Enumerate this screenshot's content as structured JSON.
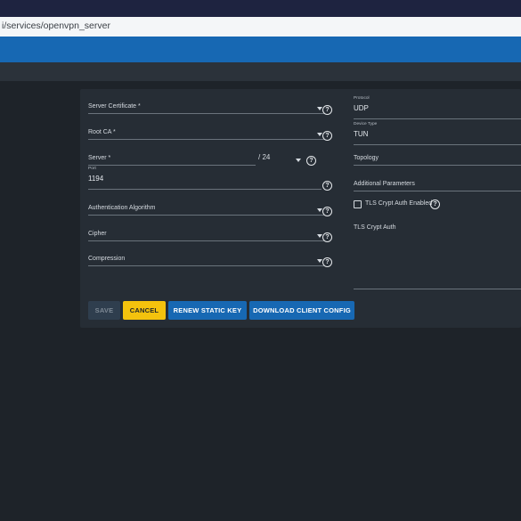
{
  "browser": {
    "url": "i/services/openvpn_server"
  },
  "form": {
    "server_certificate": {
      "label": "Server Certificate *",
      "help_icon": "help-circle-icon"
    },
    "root_ca": {
      "label": "Root CA *"
    },
    "server": {
      "label": "Server *",
      "netmask": "/ 24"
    },
    "port": {
      "label": "Port",
      "value": "1194"
    },
    "auth_algorithm": {
      "label": "Authentication Algorithm"
    },
    "cipher": {
      "label": "Cipher"
    },
    "compression": {
      "label": "Compression"
    },
    "protocol": {
      "label": "Protocol",
      "value": "UDP"
    },
    "device_type": {
      "label": "Device Type",
      "value": "TUN"
    },
    "topology": {
      "label": "Topology"
    },
    "additional_parameters": {
      "label": "Additional Parameters"
    },
    "tls_crypt_auth_enabled": {
      "label": "TLS Crypt Auth Enabled",
      "checked": false
    },
    "tls_crypt_auth": {
      "label": "TLS Crypt Auth"
    }
  },
  "buttons": {
    "save": "SAVE",
    "cancel": "CANCEL",
    "renew": "RENEW STATIC KEY",
    "download": "DOWNLOAD CLIENT CONFIG"
  },
  "colors": {
    "primary": "#1768b3",
    "accent": "#f4c20d",
    "background": "#1e2329",
    "card": "#262d35"
  }
}
